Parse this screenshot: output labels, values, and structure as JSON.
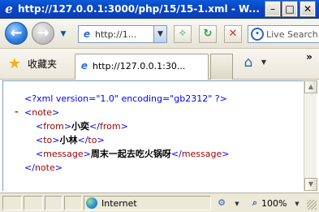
{
  "window": {
    "title": "http://127.0.0.1:3000/php/15/15-1.xml - W...",
    "minimize_glyph": "–",
    "maximize_glyph": "□",
    "close_glyph": "✕"
  },
  "navbar": {
    "back_glyph": "←",
    "forward_glyph": "→",
    "dropdown_glyph": "▼",
    "address_value": "http://1...",
    "compat_glyph": "✧",
    "refresh_glyph": "↻",
    "stop_glyph": "✕",
    "search_placeholder": "Live Search",
    "search_logo_glyph": "•"
  },
  "favorites": {
    "star_glyph": "★",
    "label": "收藏夹",
    "tab_label": "http://127.0.0.1:30...",
    "page_icon_glyph": "e",
    "home_glyph": "⌂",
    "more_glyph": "»"
  },
  "xml": {
    "declaration": "<?xml version=\"1.0\" encoding=\"gb2312\" ?>",
    "collapse_toggle": "-",
    "root_tag": "note",
    "elements": [
      {
        "tag": "from",
        "value": "小奕"
      },
      {
        "tag": "to",
        "value": "小林"
      },
      {
        "tag": "message",
        "value": "周末一起去吃火锅呀"
      }
    ]
  },
  "scroll": {
    "up_glyph": "▲",
    "down_glyph": "▼"
  },
  "status": {
    "zone": "Internet",
    "protect_glyph": "⚙",
    "zoom_glyph": "⌕",
    "zoom": "100%"
  },
  "colors": {
    "titlebar": "#0a46c6",
    "xml_tag": "#990000",
    "xml_bracket": "#0000ff",
    "collapse_toggle": "#ff0000"
  }
}
